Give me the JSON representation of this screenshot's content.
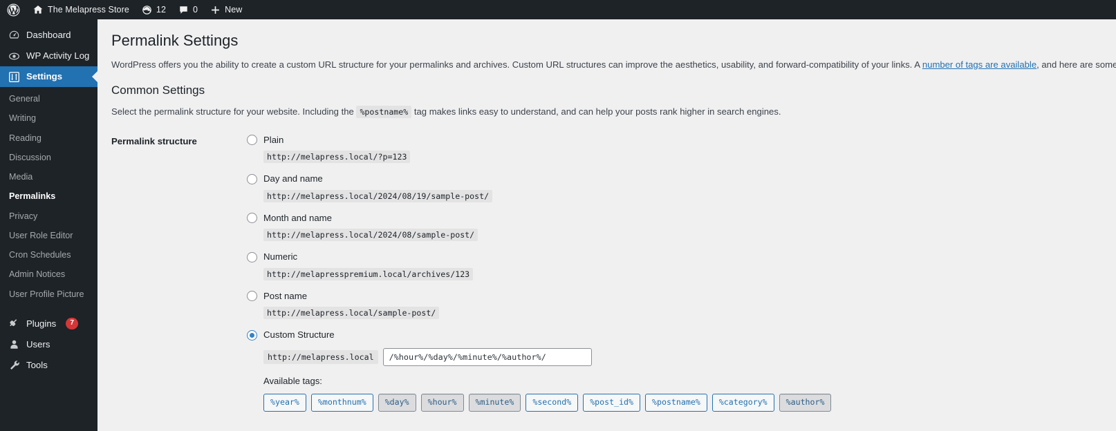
{
  "adminbar": {
    "logo_icon": "wordpress-logo-icon",
    "site": {
      "icon": "home-icon",
      "label": "The Melapress Store"
    },
    "updates": {
      "icon": "updates-icon",
      "count": "12"
    },
    "comments": {
      "icon": "comment-bubble-icon",
      "count": "0"
    },
    "new": {
      "icon": "plus-icon",
      "label": "New"
    }
  },
  "sidebar": {
    "menu": [
      {
        "icon": "dashboard-icon",
        "label": "Dashboard",
        "current": false
      },
      {
        "icon": "eye-icon",
        "label": "WP Activity Log",
        "current": false
      },
      {
        "icon": "settings-sliders-icon",
        "label": "Settings",
        "current": true
      }
    ],
    "submenu": [
      {
        "label": "General",
        "current": false
      },
      {
        "label": "Writing",
        "current": false
      },
      {
        "label": "Reading",
        "current": false
      },
      {
        "label": "Discussion",
        "current": false
      },
      {
        "label": "Media",
        "current": false
      },
      {
        "label": "Permalinks",
        "current": true
      },
      {
        "label": "Privacy",
        "current": false
      },
      {
        "label": "User Role Editor",
        "current": false
      },
      {
        "label": "Cron Schedules",
        "current": false
      },
      {
        "label": "Admin Notices",
        "current": false
      },
      {
        "label": "User Profile Picture",
        "current": false
      }
    ],
    "menu_bottom": [
      {
        "icon": "plugins-icon",
        "label": "Plugins",
        "badge": "7"
      },
      {
        "icon": "users-icon",
        "label": "Users",
        "badge": ""
      },
      {
        "icon": "tools-wrench-icon",
        "label": "Tools",
        "badge": ""
      }
    ]
  },
  "page": {
    "title": "Permalink Settings",
    "intro_before": "WordPress offers you the ability to create a custom URL structure for your permalinks and archives. Custom URL structures can improve the aesthetics, usability, and forward-compatibility of your links. A ",
    "intro_link": "number of tags are available",
    "intro_after": ", and here are some examples to get you started.",
    "section_title": "Common Settings",
    "section_desc_before": "Select the permalink structure for your website. Including the ",
    "section_desc_code": "%postname%",
    "section_desc_after": " tag makes links easy to understand, and can help your posts rank higher in search engines.",
    "row_label": "Permalink structure"
  },
  "options": [
    {
      "label": "Plain",
      "example": "http://melapress.local/?p=123",
      "selected": false
    },
    {
      "label": "Day and name",
      "example": "http://melapress.local/2024/08/19/sample-post/",
      "selected": false
    },
    {
      "label": "Month and name",
      "example": "http://melapress.local/2024/08/sample-post/",
      "selected": false
    },
    {
      "label": "Numeric",
      "example": "http://melapresspremium.local/archives/123",
      "selected": false
    },
    {
      "label": "Post name",
      "example": "http://melapress.local/sample-post/",
      "selected": false
    }
  ],
  "custom": {
    "label": "Custom Structure",
    "selected": true,
    "prefix": "http://melapress.local",
    "value": "/%hour%/%day%/%minute%/%author%/",
    "available_label": "Available tags:",
    "tags": [
      {
        "label": "%year%",
        "used": false
      },
      {
        "label": "%monthnum%",
        "used": false
      },
      {
        "label": "%day%",
        "used": true
      },
      {
        "label": "%hour%",
        "used": true
      },
      {
        "label": "%minute%",
        "used": true
      },
      {
        "label": "%second%",
        "used": false
      },
      {
        "label": "%post_id%",
        "used": false
      },
      {
        "label": "%postname%",
        "used": false
      },
      {
        "label": "%category%",
        "used": false
      },
      {
        "label": "%author%",
        "used": true
      }
    ]
  },
  "colors": {
    "admin_dark": "#1d2327",
    "accent_blue": "#2271b1",
    "link_blue": "#2271b1",
    "badge_red": "#d63638",
    "content_bg": "#f0f0f1",
    "code_bg": "#e3e3e4"
  }
}
